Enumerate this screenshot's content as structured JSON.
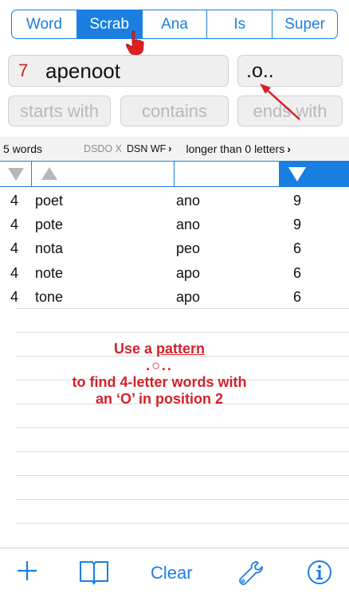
{
  "segments": [
    {
      "label": "Word",
      "active": false
    },
    {
      "label": "Scrab",
      "active": true
    },
    {
      "label": "Ana",
      "active": false
    },
    {
      "label": "Is",
      "active": false
    },
    {
      "label": "Super",
      "active": false
    }
  ],
  "letters_field": {
    "count": "7",
    "value": "apenoot"
  },
  "pattern_field": {
    "value": ".o.."
  },
  "placeholders": {
    "starts_with": "starts with",
    "contains": "contains",
    "ends_with": "ends with"
  },
  "status": {
    "word_count": "5 words",
    "dictionary": "DSDO X",
    "dictionary_set": "DSN WF",
    "length_filter": "longer than 0 letters"
  },
  "results": [
    {
      "length": "4",
      "word": "poet",
      "extra": "ano",
      "score": "9"
    },
    {
      "length": "4",
      "word": "pote",
      "extra": "ano",
      "score": "9"
    },
    {
      "length": "4",
      "word": "nota",
      "extra": "peo",
      "score": "6"
    },
    {
      "length": "4",
      "word": "note",
      "extra": "apo",
      "score": "6"
    },
    {
      "length": "4",
      "word": "tone",
      "extra": "apo",
      "score": "6"
    }
  ],
  "annotation": {
    "line1_prefix": "Use a ",
    "line1_underlined": "pattern",
    "line2": ".○..",
    "line3": "to find 4-letter words with",
    "line4": "an ‘O’ in position 2"
  },
  "toolbar": {
    "clear_label": "Clear"
  },
  "colors": {
    "accent": "#1a7fe0",
    "annotation_red": "#d4202a",
    "count_red": "#c21f1f"
  },
  "icons": [
    "hand-pointer-icon",
    "red-arrow-icon",
    "chevron-right-icon",
    "sort-down-icon",
    "sort-up-icon",
    "plus-icon",
    "book-icon",
    "wrench-icon",
    "info-icon"
  ]
}
